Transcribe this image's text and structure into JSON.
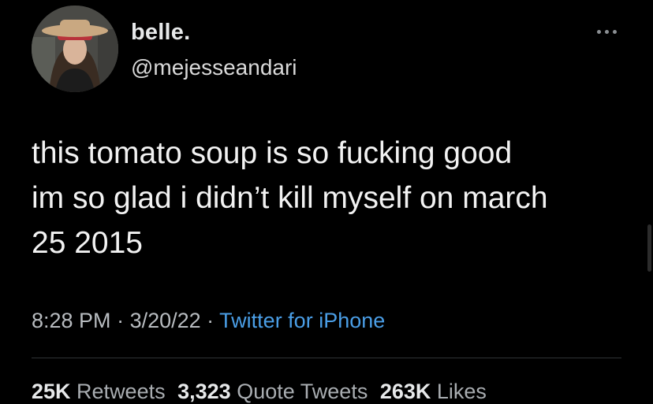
{
  "user": {
    "display_name": "belle.",
    "handle": "@mejesseandari",
    "avatar_icon": "profile-avatar"
  },
  "menu": {
    "more_icon": "more-horizontal-icon"
  },
  "tweet": {
    "text": "this tomato soup is so fucking good\nim so glad i didn’t kill myself on march\n25 2015",
    "time": "8:28 PM",
    "separator": " · ",
    "date": "3/20/22",
    "source": "Twitter for iPhone"
  },
  "stats": {
    "retweets_count": "25K",
    "retweets_label": "Retweets",
    "quotes_count": "3,323",
    "quotes_label": "Quote Tweets",
    "likes_count": "263K",
    "likes_label": "Likes"
  },
  "colors": {
    "background": "#000000",
    "text": "#e7e9ea",
    "secondary": "#b8bcc0",
    "link": "#4a9ee6"
  }
}
